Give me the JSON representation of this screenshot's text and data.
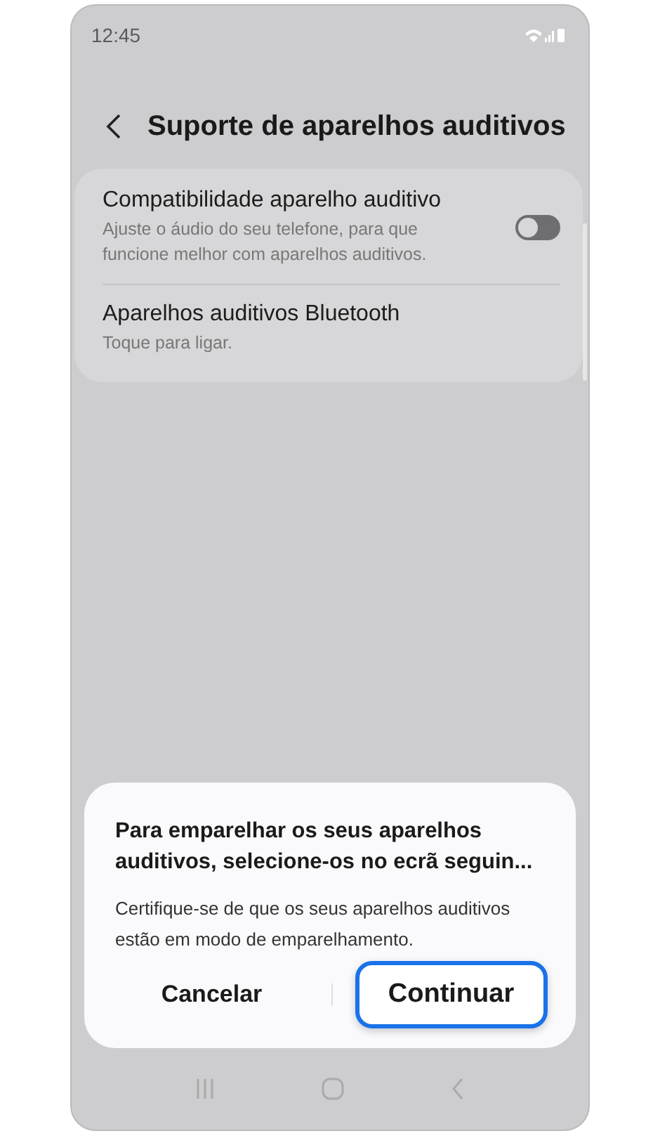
{
  "status_bar": {
    "time": "12:45"
  },
  "header": {
    "title": "Suporte de aparelhos auditivos"
  },
  "settings": [
    {
      "kind": "toggle",
      "title": "Compatibilidade aparelho auditivo",
      "subtitle": "Ajuste o áudio do seu telefone, para que funcione melhor com aparelhos auditivos.",
      "on": false
    },
    {
      "kind": "link",
      "title": "Aparelhos auditivos Bluetooth",
      "subtitle": "Toque para ligar."
    }
  ],
  "dialog": {
    "title": "Para emparelhar os seus aparelhos auditivos, selecione-os no ecrã seguin...",
    "message": "Certifique-se de que os seus aparelhos auditivos estão em modo de emparelhamento.",
    "buttons": [
      {
        "label": "Cancelar",
        "highlighted": false
      },
      {
        "label": "Continuar",
        "highlighted": true
      }
    ]
  }
}
